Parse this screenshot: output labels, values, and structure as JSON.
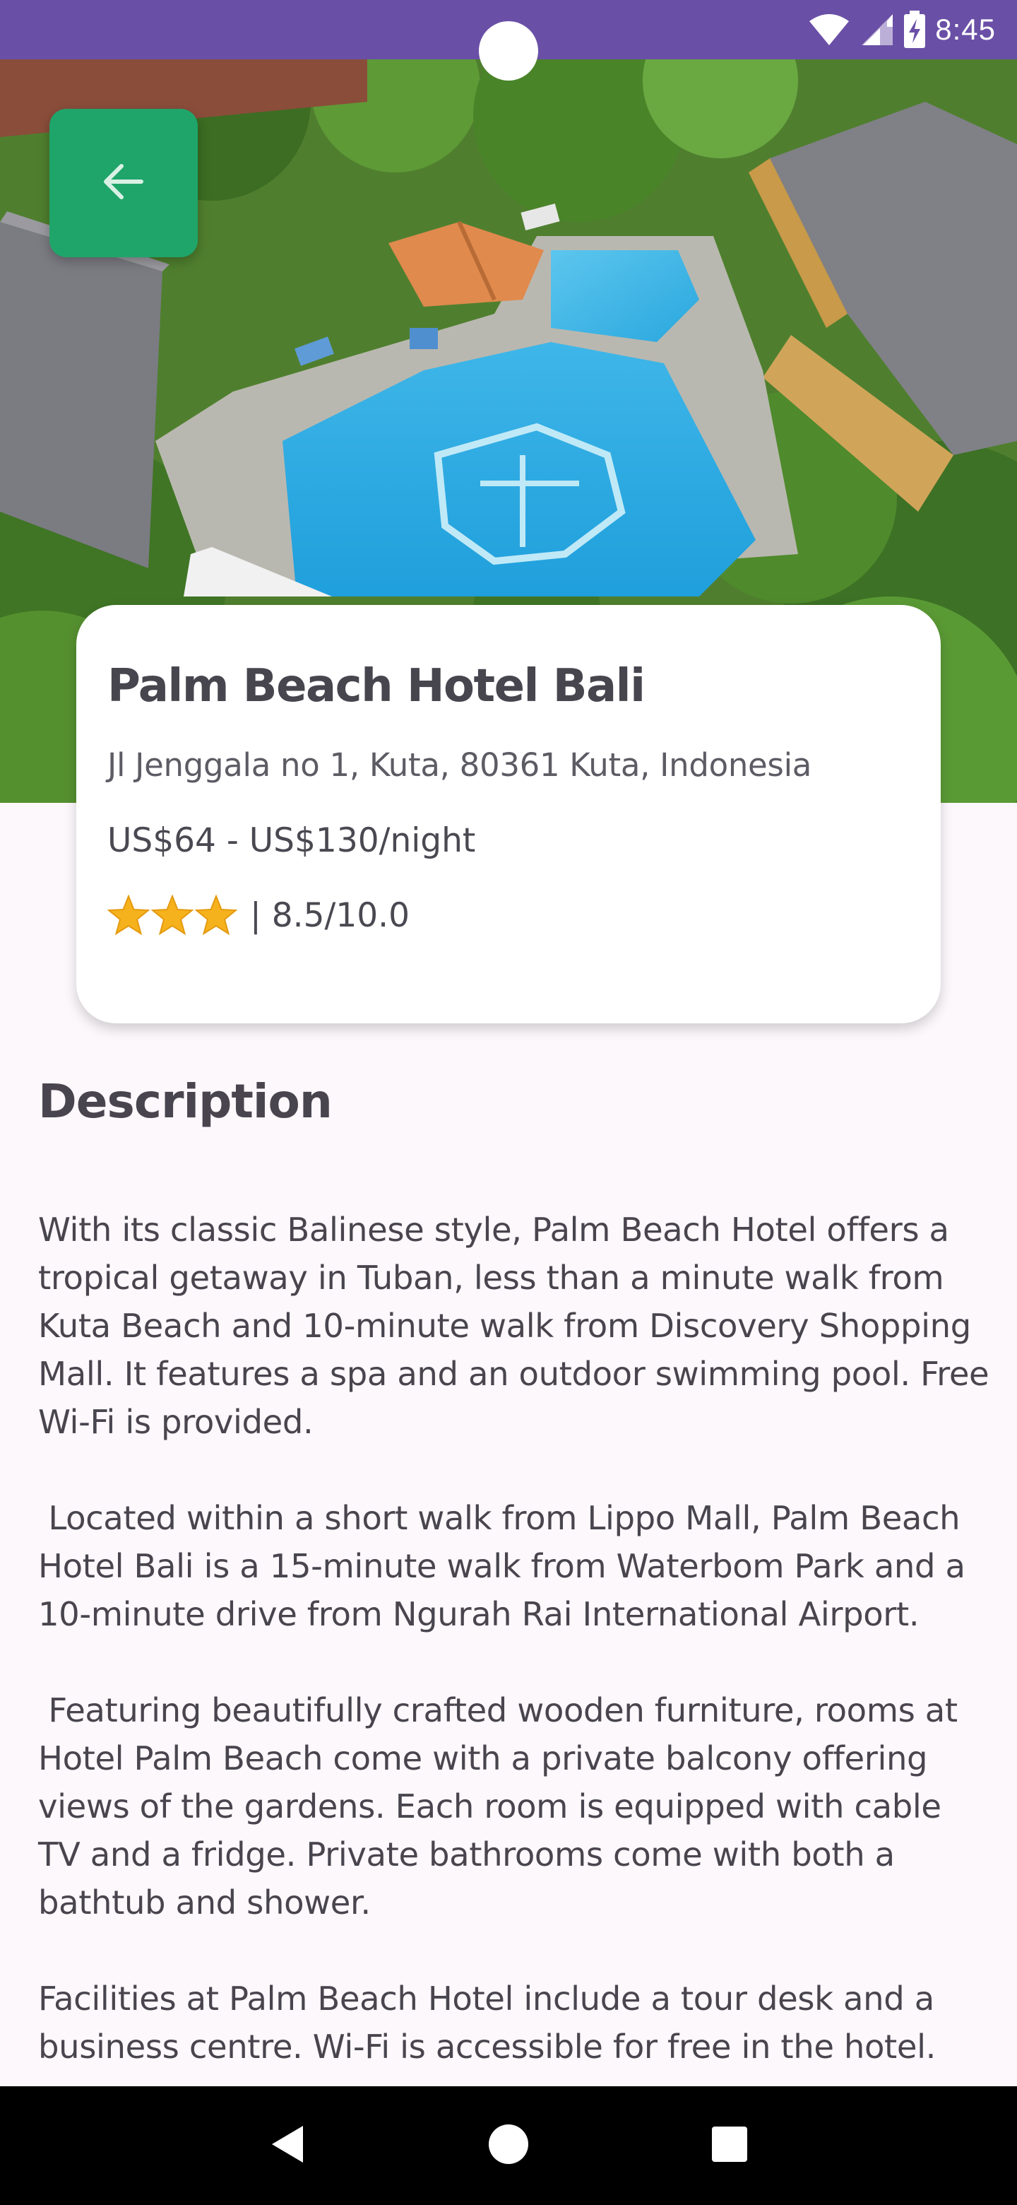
{
  "status_bar": {
    "time": "8:45",
    "icons": [
      "wifi-icon",
      "cellular-signal-icon",
      "battery-charging-icon"
    ]
  },
  "header": {
    "back_icon": "arrow-left-icon",
    "back_button_color": "#1fa56a"
  },
  "hotel": {
    "name": "Palm Beach Hotel Bali",
    "address": "Jl Jenggala no 1, Kuta, 80361 Kuta, Indonesia",
    "price": "US$64 - US$130/night",
    "star_count": 3,
    "rating": "| 8.5/10.0"
  },
  "description": {
    "title": "Description",
    "body": "With its classic Balinese style, Palm Beach Hotel offers a tropical getaway in Tuban, less than a minute walk from Kuta Beach and 10-minute walk from Discovery Shopping Mall. It features a spa and an outdoor swimming pool. Free Wi-Fi is provided.\n\n Located within a short walk from Lippo Mall, Palm Beach Hotel Bali is a 15-minute walk from Waterbom Park and a 10-minute drive from Ngurah Rai International Airport.\n\n Featuring beautifully crafted wooden furniture, rooms at Hotel Palm Beach come with a private balcony offering views of the gardens. Each room is equipped with cable TV and a fridge. Private bathrooms come with both a bathtub and shower.\n\nFacilities at Palm Beach Hotel include a tour desk and a business centre. Wi-Fi is accessible for free in the hotel."
  },
  "colors": {
    "status_bar": "#6a4fa6",
    "background": "#fcf8fc",
    "text": "#48454e",
    "star": "#f6b21c"
  },
  "nav_bar": {
    "icons": [
      "back-triangle-icon",
      "home-circle-icon",
      "recents-square-icon"
    ]
  }
}
